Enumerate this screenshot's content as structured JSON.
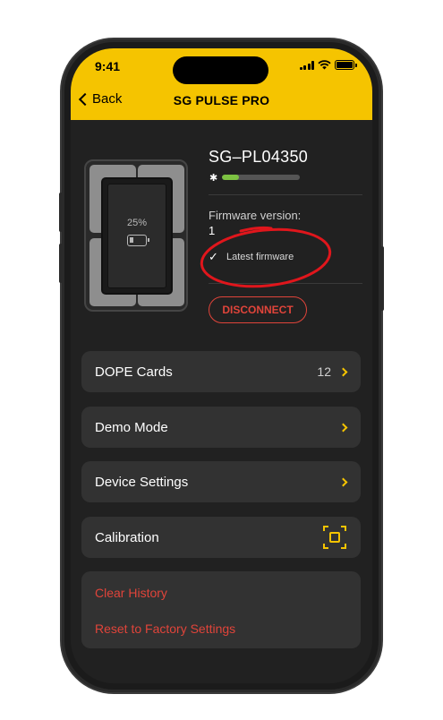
{
  "status_bar": {
    "time": "9:41"
  },
  "nav": {
    "back_label": "Back",
    "title": "SG PULSE PRO"
  },
  "device": {
    "name": "SG–PL04350",
    "battery_percent_label": "25%",
    "battery_level": 0.25,
    "signal_strength": 0.22,
    "bluetooth_icon": "bluetooth-icon",
    "firmware_label": "Firmware version:",
    "firmware_value": "1",
    "firmware_status": "Latest firmware",
    "disconnect_label": "DISCONNECT"
  },
  "menu": {
    "dope_cards": {
      "label": "DOPE Cards",
      "count": "12"
    },
    "demo_mode": {
      "label": "Demo Mode"
    },
    "device_settings": {
      "label": "Device Settings"
    },
    "calibration": {
      "label": "Calibration"
    }
  },
  "danger": {
    "clear_history": "Clear History",
    "factory_reset": "Reset to Factory Settings"
  },
  "colors": {
    "accent": "#f5c400",
    "danger": "#e0443a",
    "background": "#212121",
    "card": "#323232",
    "signal": "#7dc242",
    "annotation": "#e0161c"
  }
}
